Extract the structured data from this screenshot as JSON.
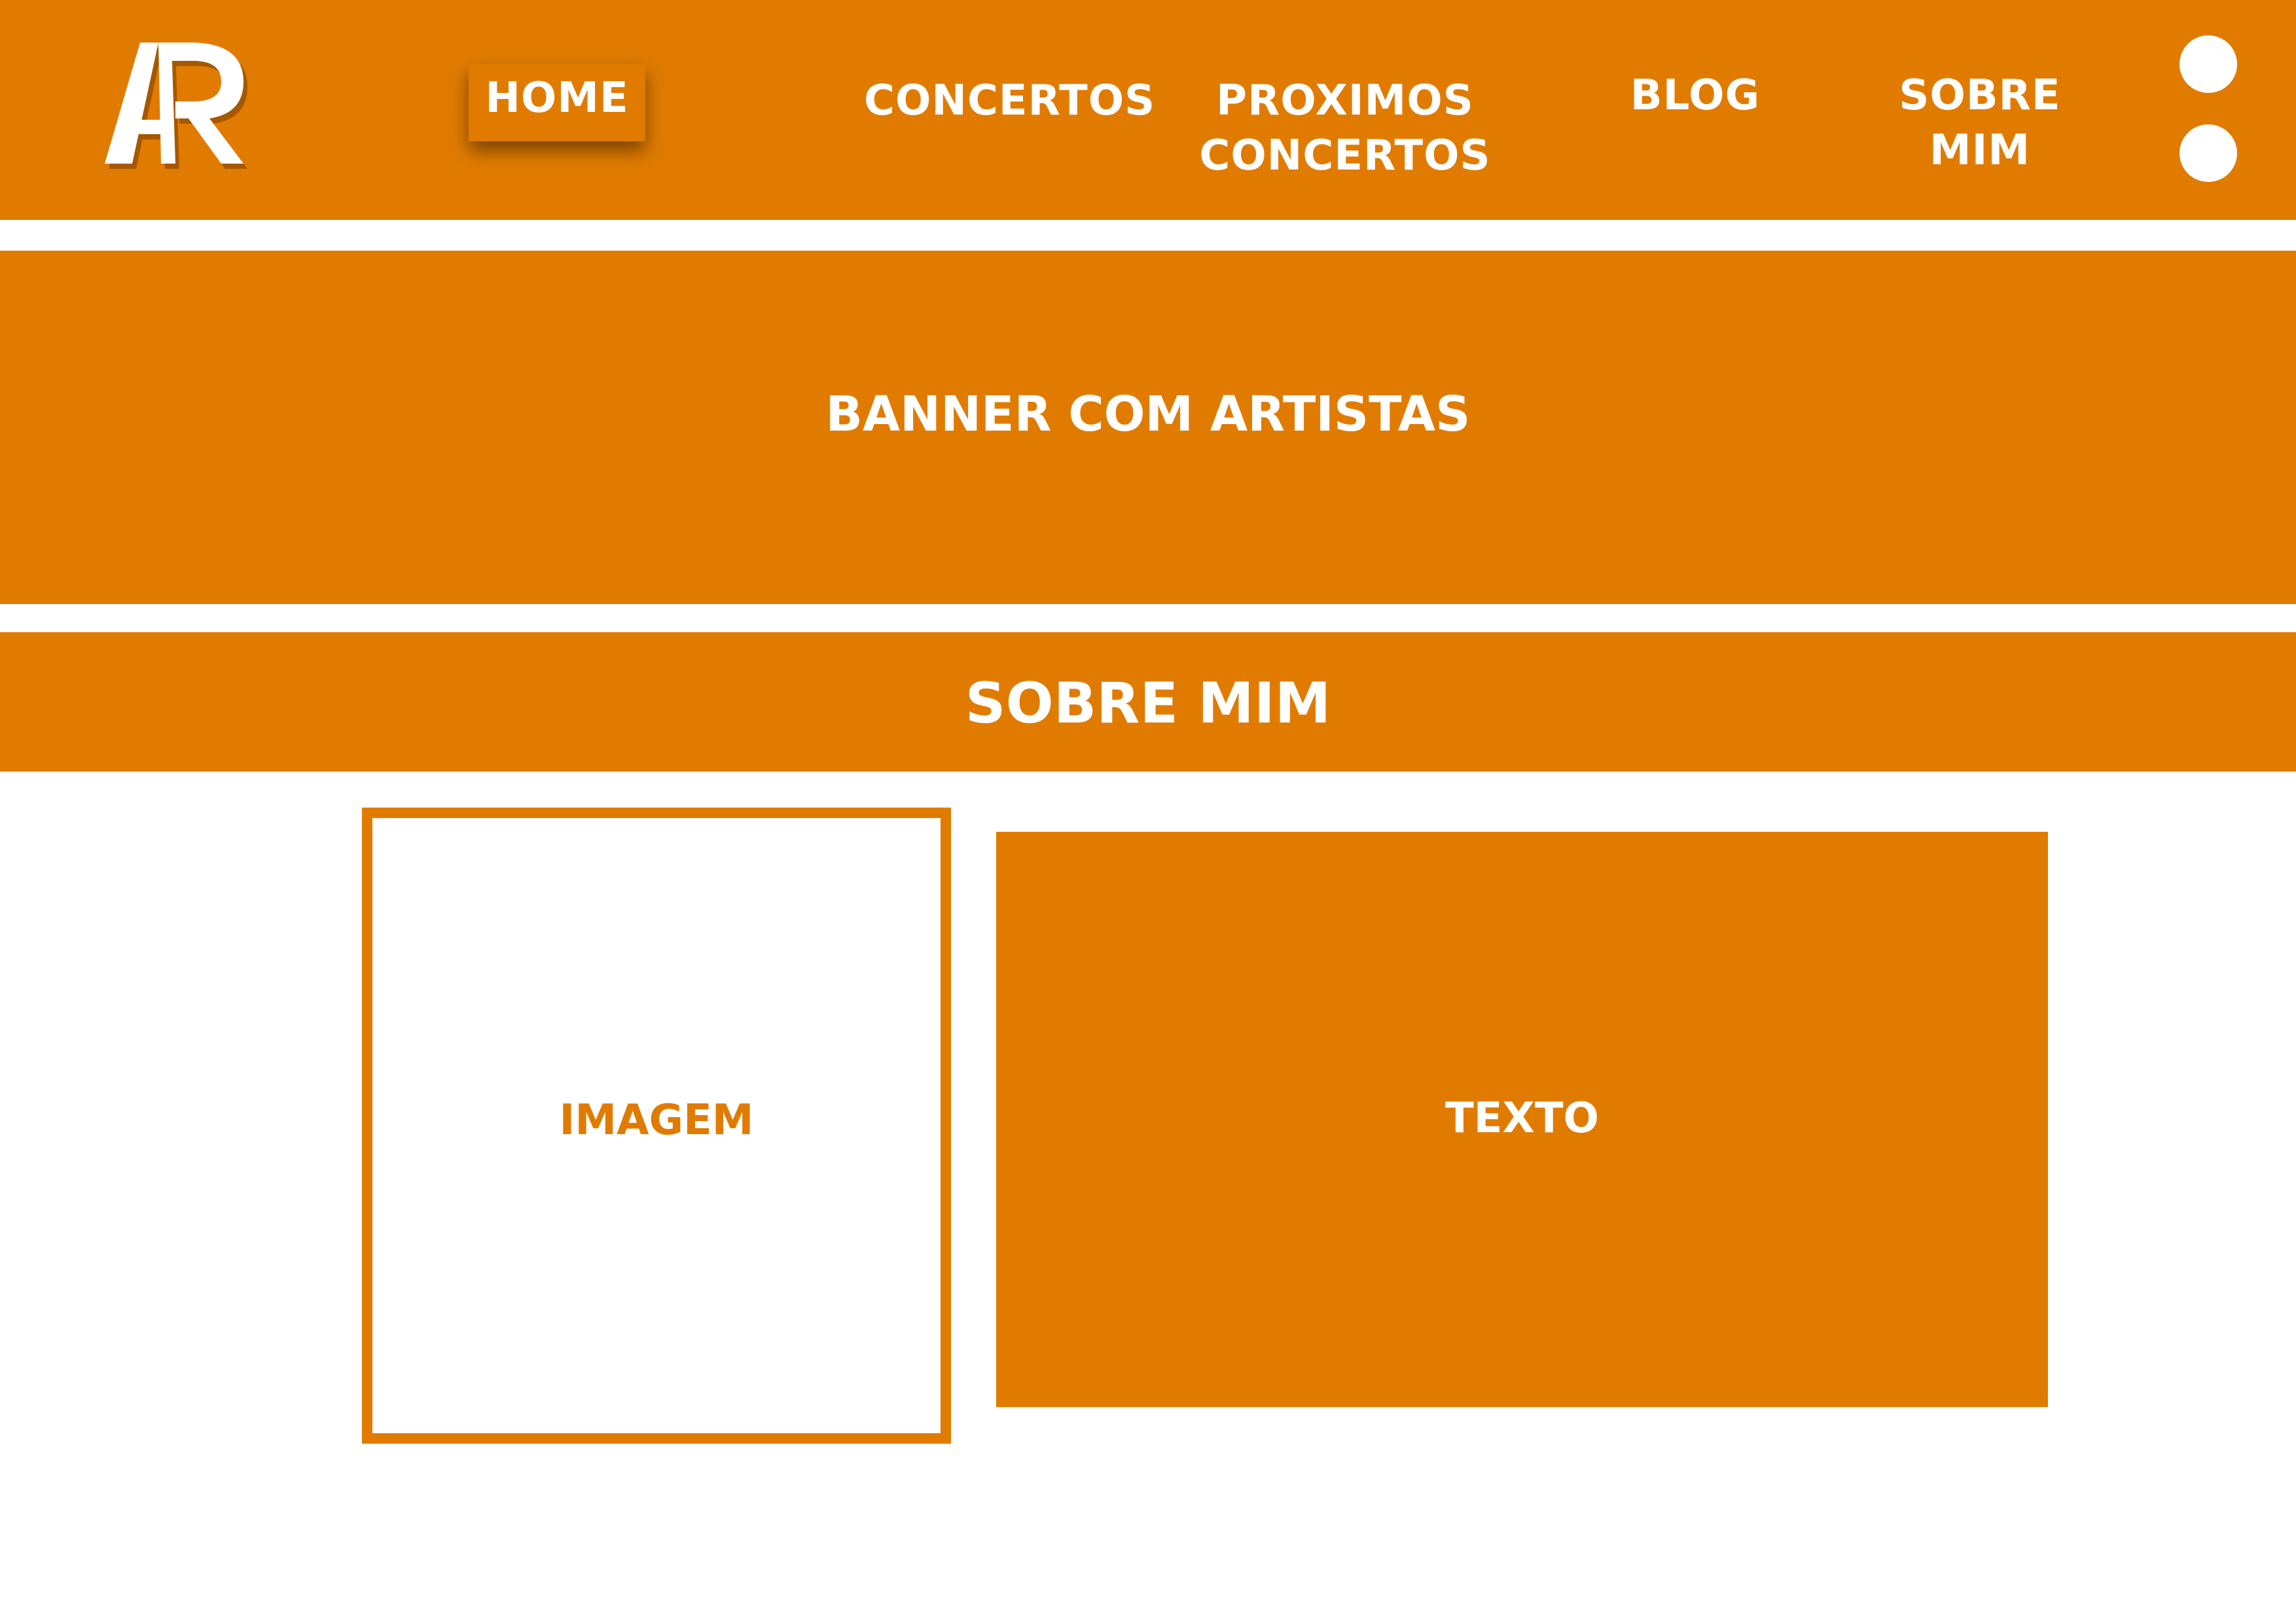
{
  "colors": {
    "accent": "#e07b00",
    "background": "#ffffff",
    "text_on_accent": "#ffffff"
  },
  "header": {
    "logo": "AR",
    "nav": {
      "home": "HOME",
      "concertos": "CONCERTOS",
      "proximos_line1": "PROXIMOS",
      "proximos_line2": "CONCERTOS",
      "blog": "BLOG",
      "sobre_mim": "SOBRE MIM"
    },
    "active_item": "HOME",
    "icons": [
      "circle-icon",
      "circle-icon"
    ]
  },
  "banner": {
    "title": "BANNER COM ARTISTAS"
  },
  "about": {
    "title": "SOBRE MIM",
    "image_label": "IMAGEM",
    "text_label": "TEXTO"
  }
}
